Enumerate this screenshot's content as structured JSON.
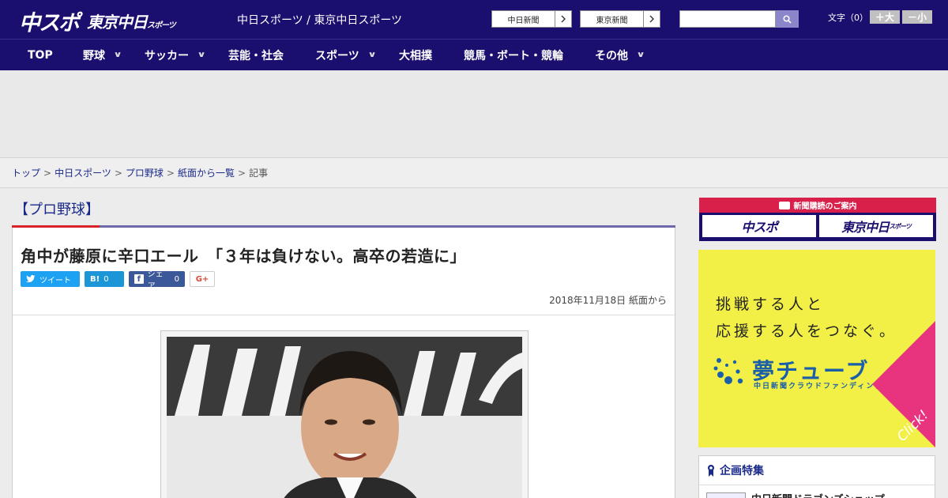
{
  "header": {
    "logo_primary": "中スポ",
    "logo_secondary": "東京中日",
    "logo_secondary_small": "スポーツ",
    "site_title": "中日スポーツ / 東京中日スポーツ",
    "paper_links": [
      {
        "label": "中日新聞"
      },
      {
        "label": "東京新聞"
      }
    ],
    "search": {
      "value": "",
      "placeholder": ""
    },
    "font_size_label": "文字（0）",
    "font_bigger": "＋大",
    "font_smaller": "－小"
  },
  "nav": [
    {
      "label": "TOP",
      "has_menu": false
    },
    {
      "label": "野球",
      "has_menu": true
    },
    {
      "label": "サッカー",
      "has_menu": true
    },
    {
      "label": "芸能・社会",
      "has_menu": false
    },
    {
      "label": "スポーツ",
      "has_menu": true
    },
    {
      "label": "大相撲",
      "has_menu": false
    },
    {
      "label": "競馬・ボート・競輪",
      "has_menu": false
    },
    {
      "label": "その他",
      "has_menu": true
    }
  ],
  "breadcrumb": {
    "items": [
      "トップ",
      "中日スポーツ",
      "プロ野球",
      "紙面から一覧"
    ],
    "current": "記事",
    "separator": ">"
  },
  "article": {
    "category": "【プロ野球】",
    "headline": "角中が藤原に辛口エール　「３年は負けない。高卒の若造に」",
    "share": {
      "tweet_label": "ツイート",
      "hatena_label": "B!",
      "hatena_count": "0",
      "facebook_label": "シェア",
      "facebook_count": "0",
      "google_label": "G+"
    },
    "date": "2018年11月18日 紙面から"
  },
  "sidebar": {
    "subscription_title": "新聞購読のご案内",
    "subscription_logos": [
      "中スポ",
      "東京中日"
    ],
    "subscription_logo_small": "スポーツ",
    "ad": {
      "line1": "挑戦する人と",
      "line2": "応援する人をつなぐ。",
      "brand": "夢チューブ",
      "brand_sub": "中日新聞クラウドファンディング",
      "cta": "Click!"
    },
    "feature_title": "企画特集",
    "feature_item": "中日新聞ドラゴンズショップ"
  },
  "colors": {
    "header_bg": "#1a0f6e",
    "accent_red": "#d92128",
    "link": "#1a2a8a",
    "ad_yellow": "#f2f046",
    "ad_pink": "#e8337e"
  }
}
